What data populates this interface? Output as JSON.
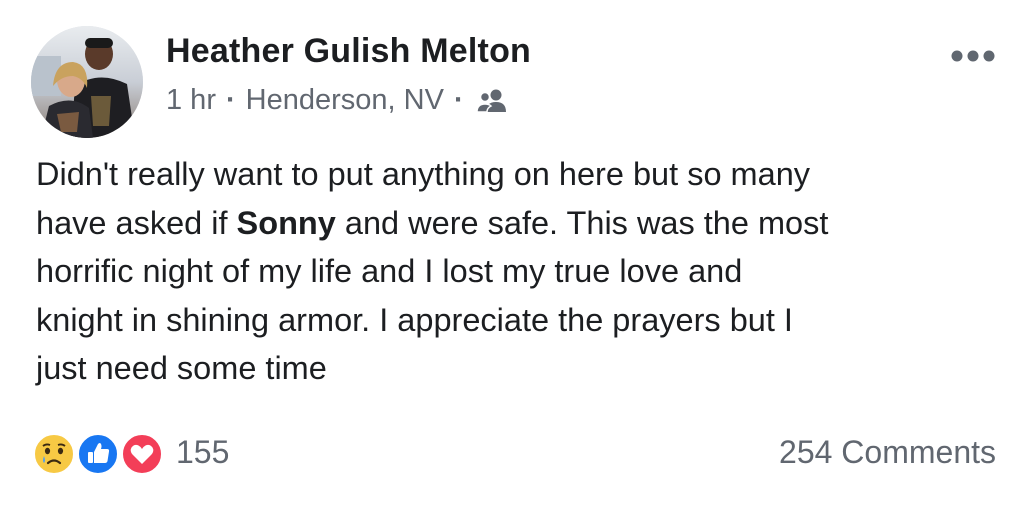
{
  "post": {
    "author": "Heather Gulish Melton",
    "meta": {
      "time": "1 hr",
      "separator": "·",
      "location": "Henderson, NV",
      "audience_icon": "friends-icon"
    },
    "more_icon": "more-options-icon",
    "message": {
      "line1": "Didn't really want to put anything on here but so many",
      "line2_before": "have asked if ",
      "line2_bold": "Sonny",
      "line2_after": " and were safe. This was the most",
      "line3": "horrific night of my life and I lost my true love and",
      "line4": "knight in shining armor.  I appreciate the prayers but I",
      "line5": "just need some time"
    },
    "footer": {
      "reactions": [
        "sad-reaction-icon",
        "like-reaction-icon",
        "love-reaction-icon"
      ],
      "reaction_count": "155",
      "comments": "254 Comments"
    },
    "colors": {
      "text": "#1c1e21",
      "secondary": "#616770",
      "like_blue": "#1877f2",
      "love_red": "#f33e58",
      "sad_yellow": "#f7c944"
    }
  }
}
